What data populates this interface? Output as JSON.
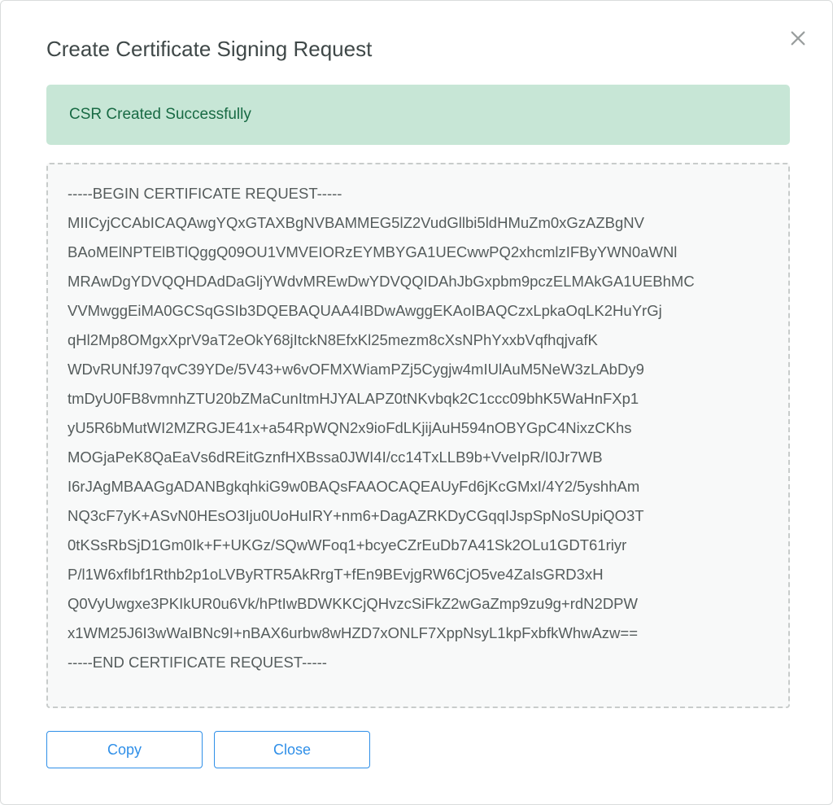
{
  "modal": {
    "title": "Create Certificate Signing Request",
    "success_message": "CSR Created Successfully",
    "csr_lines": [
      "-----BEGIN CERTIFICATE REQUEST-----",
      "MIICyjCCAbICAQAwgYQxGTAXBgNVBAMMEG5lZ2VudGllbi5ldHMuZm0xGzAZBgNV",
      "BAoMElNPTElBTlQggQ09OU1VMVEIORzEYMBYGA1UECwwPQ2xhcmlzIFByYWN0aWNl",
      "MRAwDgYDVQQHDAdDaGljYWdvMREwDwYDVQQIDAhJbGxpbm9pczELMAkGA1UEBhMC",
      "VVMwggEiMA0GCSqGSIb3DQEBAQUAA4IBDwAwggEKAoIBAQCzxLpkaOqLK2HuYrGj",
      "qHl2Mp8OMgxXprV9aT2eOkY68jItckN8EfxKl25mezm8cXsNPhYxxbVqfhqjvafK",
      "WDvRUNfJ97qvC39YDe/5V43+w6vOFMXWiamPZj5Cygjw4mIUlAuM5NeW3zLAbDy9",
      "tmDyU0FB8vmnhZTU20bZMaCunItmHJYALAPZ0tNKvbqk2C1ccc09bhK5WaHnFXp1",
      "yU5R6bMutWI2MZRGJE41x+a54RpWQN2x9ioFdLKjijAuH594nOBYGpC4NixzCKhs",
      "MOGjaPeK8QaEaVs6dREitGznfHXBssa0JWI4I/cc14TxLLB9b+VveIpR/I0Jr7WB",
      "I6rJAgMBAAGgADANBgkqhkiG9w0BAQsFAAOCAQEAUyFd6jKcGMxI/4Y2/5yshhAm",
      "NQ3cF7yK+ASvN0HEsO3Iju0UoHuIRY+nm6+DagAZRKDyCGqqIJspSpNoSUpiQO3T",
      "0tKSsRbSjD1Gm0Ik+F+UKGz/SQwWFoq1+bcyeCZrEuDb7A41Sk2OLu1GDT61riyr",
      "P/l1W6xfIbf1Rthb2p1oLVByRTR5AkRrgT+fEn9BEvjgRW6CjO5ve4ZaIsGRD3xH",
      "Q0VyUwgxe3PKIkUR0u6Vk/hPtIwBDWKKCjQHvzcSiFkZ2wGaZmp9zu9g+rdN2DPW",
      "x1WM25J6I3wWaIBNc9I+nBAX6urbw8wHZD7xONLF7XppNsyL1kpFxbfkWhwAzw==",
      "-----END CERTIFICATE REQUEST-----"
    ],
    "buttons": {
      "copy": "Copy",
      "close": "Close"
    }
  }
}
